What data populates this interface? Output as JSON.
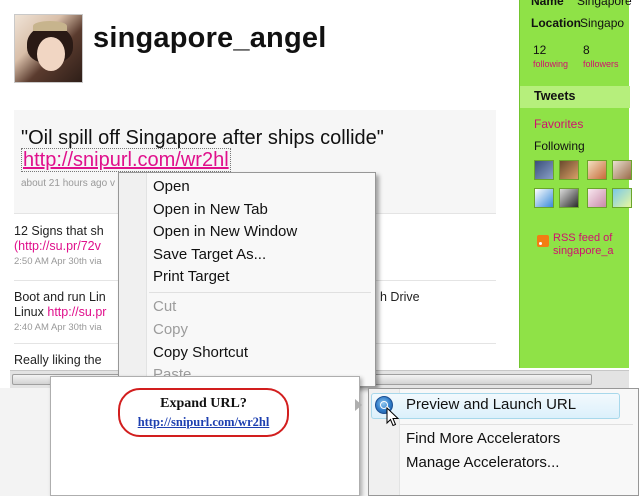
{
  "profile": {
    "screen_name": "singapore_angel"
  },
  "status": {
    "text": "\"Oil spill off Singapore after ships collide\"",
    "link": "http://snipurl.com/wr2hl",
    "meta": "about 21 hours ago v"
  },
  "feed": [
    {
      "text": "12 Signs that sh",
      "link": "(http://su.pr/72v",
      "meta": "2:50 AM Apr 30th via"
    },
    {
      "text": "Boot and run Lin",
      "text2": "Linux",
      "link": "http://su.pr",
      "right_text": "h Drive",
      "meta": "2:40 AM Apr 30th via"
    },
    {
      "text": "Really liking the"
    }
  ],
  "sidebar": {
    "name_label": "Name",
    "name_value": "Singapore",
    "location_label": "Location",
    "location_value": "Singapo",
    "following_count": "12",
    "following_label": "following",
    "followers_count": "8",
    "followers_label": "followers",
    "tweets_tab": "Tweets",
    "favorites": "Favorites",
    "following_header": "Following",
    "rss_line1": "RSS feed of",
    "rss_line2": "singapore_a"
  },
  "context_menu": {
    "items": [
      "Open",
      "Open in New Tab",
      "Open in New Window",
      "Save Target As...",
      "Print Target"
    ],
    "items2": [
      "Cut",
      "Copy",
      "Copy Shortcut",
      "Paste"
    ]
  },
  "preview": {
    "title": "Expand URL?",
    "link": "http://snipurl.com/wr2hl"
  },
  "accelerators": {
    "items": [
      "Preview and Launch URL",
      "Find More Accelerators",
      "Manage Accelerators..."
    ]
  },
  "colors": {
    "sidebar_bg": "#8fe247",
    "link_pink": "#e0108c",
    "oval_red": "#d21e1e"
  }
}
